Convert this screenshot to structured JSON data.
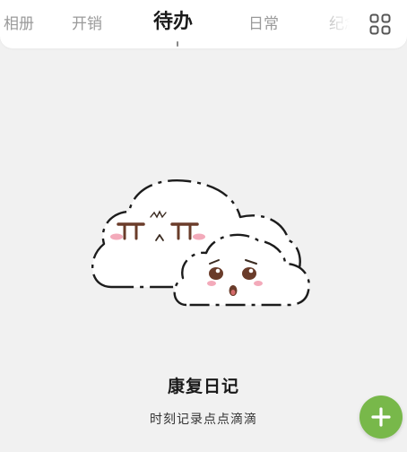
{
  "header": {
    "tabs": [
      {
        "id": "album",
        "label": "相册"
      },
      {
        "id": "expense",
        "label": "开销"
      },
      {
        "id": "todo",
        "label": "待办"
      },
      {
        "id": "daily",
        "label": "日常"
      },
      {
        "id": "memorial",
        "label": "纪念"
      }
    ],
    "active_tab": "todo",
    "grid_icon": "apps-grid-icon"
  },
  "empty_state": {
    "illustration": "cute-clouds-illustration",
    "title": "康复日记",
    "subtitle": "时刻记录点点滴滴"
  },
  "fab": {
    "icon": "plus-icon"
  },
  "colors": {
    "background": "#f1f1f1",
    "header_bg": "#ffffff",
    "active_tab": "#1b1b1b",
    "inactive_tab": "#9a9a9a",
    "fab": "#78b84a",
    "cheek_pink": "#f2a1b3"
  }
}
